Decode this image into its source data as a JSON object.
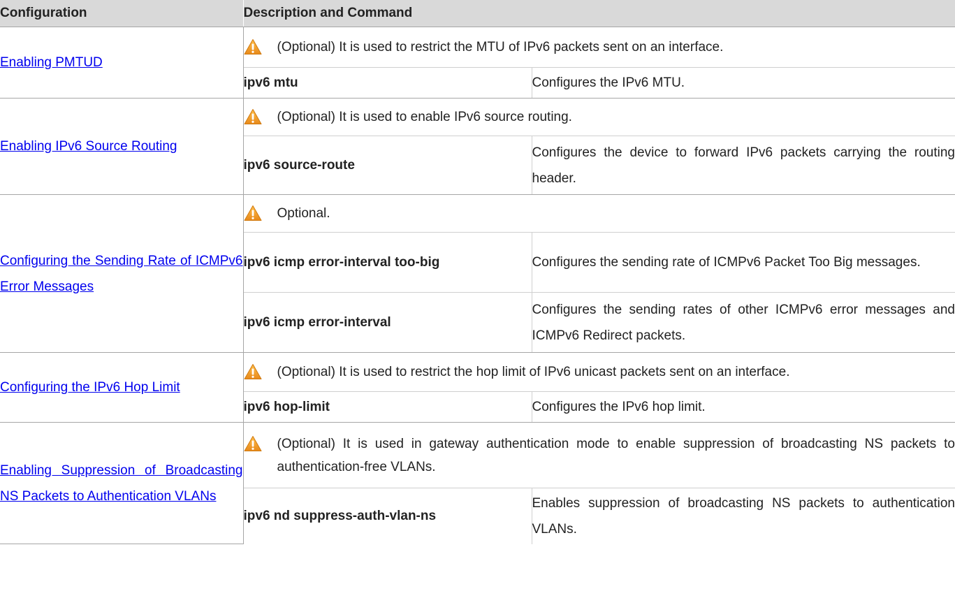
{
  "header": {
    "col1": "Configuration",
    "col2": "Description and Command"
  },
  "rows": [
    {
      "config": "Enabling PMTUD",
      "note": "(Optional) It is used to restrict the MTU of IPv6 packets sent on an interface.",
      "commands": [
        {
          "cmd": "ipv6 mtu",
          "desc": "Configures the IPv6 MTU."
        }
      ]
    },
    {
      "config": "Enabling IPv6 Source Routing",
      "note": "(Optional) It is used to enable IPv6 source routing.",
      "commands": [
        {
          "cmd": "ipv6 source-route",
          "desc": "Configures the device to forward IPv6 packets carrying the routing header."
        }
      ]
    },
    {
      "config": "Configuring the Sending Rate of ICMPv6 Error Messages",
      "note": "Optional.",
      "commands": [
        {
          "cmd": "ipv6 icmp error-interval too-big",
          "desc": "Configures the sending rate of ICMPv6 Packet Too Big messages."
        },
        {
          "cmd": "ipv6 icmp error-interval",
          "desc": "Configures the sending rates of other ICMPv6 error messages and ICMPv6 Redirect packets."
        }
      ]
    },
    {
      "config": "Configuring the IPv6 Hop Limit",
      "note": "(Optional) It is used to restrict the hop limit of IPv6 unicast packets sent on an interface.",
      "commands": [
        {
          "cmd": "ipv6 hop-limit",
          "desc": "Configures the IPv6 hop limit."
        }
      ]
    },
    {
      "config": "Enabling Suppression of Broadcasting NS Packets to Authentication VLANs",
      "note": "(Optional) It is used in gateway authentication mode to enable suppression of broadcasting NS packets to authentication-free VLANs.",
      "commands": [
        {
          "cmd": "ipv6 nd suppress-auth-vlan-ns",
          "desc": "Enables suppression of broadcasting NS packets to authentication VLANs."
        }
      ]
    }
  ],
  "icons": {
    "note_icon": "warning-icon"
  },
  "colors": {
    "header_bg": "#d9d9d9",
    "link": "#0000ee",
    "warning_fill": "#f5a623"
  }
}
